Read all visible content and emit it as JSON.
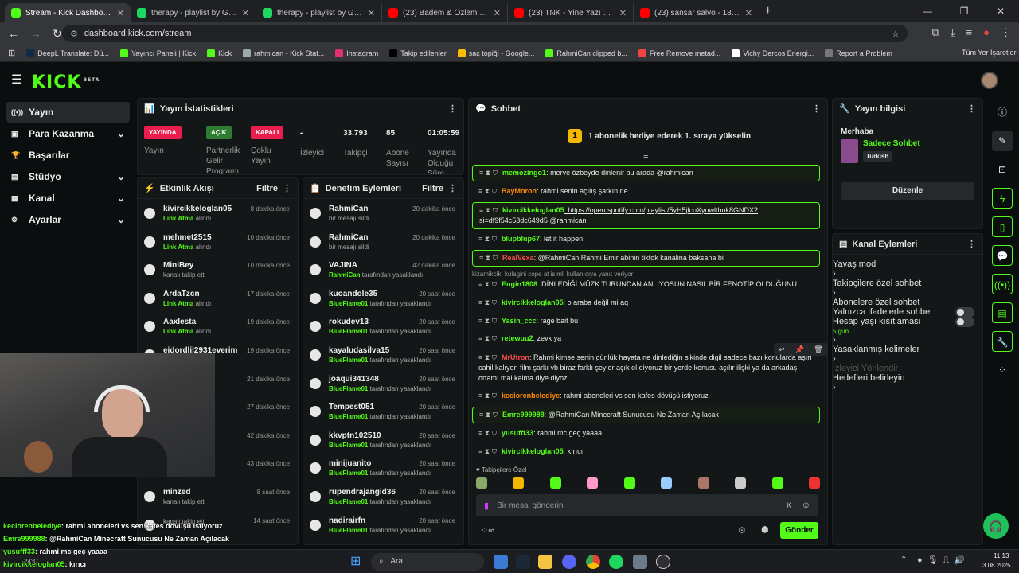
{
  "browser": {
    "tabs": [
      {
        "label": "Stream - Kick Dashboard",
        "color": "#53fc18",
        "active": true
      },
      {
        "label": "therapy - playlist by Gokdeniz",
        "color": "#1ed760"
      },
      {
        "label": "therapy - playlist by Gokdeniz",
        "color": "#1ed760"
      },
      {
        "label": "(23) Badem & Özlem Tekin - Ka",
        "color": "#ff0000"
      },
      {
        "label": "(23) TNK - Yine Yazı Bekleriz (A",
        "color": "#ff0000"
      },
      {
        "label": "(23) sansar salvo - 180 km. - Yo",
        "color": "#ff0000"
      }
    ],
    "url": "dashboard.kick.com/stream",
    "bookmarks": [
      "DeepL Translate: Dü...",
      "Yayıncı Paneli | Kick",
      "Kick",
      "rahmican - Kick Stat...",
      "Instagram",
      "Takip edilenler",
      "saç topiği - Google...",
      "RahmiCan clipped b...",
      "Free Remove metad...",
      "Vichy Dercos Energi...",
      "Report a Problem"
    ],
    "all_bookmarks": "Tüm Yer İşaretleri"
  },
  "kick": {
    "logo": "KICK",
    "logo_sup": "BETA"
  },
  "sidebar": [
    {
      "label": "Yayın",
      "icon": "broadcast-icon",
      "active": true
    },
    {
      "label": "Para Kazanma",
      "icon": "money-icon",
      "chev": true
    },
    {
      "label": "Başarılar",
      "icon": "trophy-icon"
    },
    {
      "label": "Stüdyo",
      "icon": "studio-icon",
      "chev": true
    },
    {
      "label": "Kanal",
      "icon": "channel-icon",
      "chev": true
    },
    {
      "label": "Ayarlar",
      "icon": "settings-icon",
      "chev": true
    }
  ],
  "stats": {
    "title": "Yayın İstatistikleri",
    "items": [
      {
        "badge": "YAYINDA",
        "badge_color": "#e91e4e",
        "label": "Yayın"
      },
      {
        "badge": "AÇIK",
        "badge_color": "#2e7d32",
        "label": "Partnerlik Gelir Programı"
      },
      {
        "badge": "KAPALI",
        "badge_color": "#e91e4e",
        "label": "Çoklu Yayın"
      },
      {
        "value": "-",
        "label": "İzleyici"
      },
      {
        "value": "33.793",
        "label": "Takipçi"
      },
      {
        "value": "85",
        "label": "Abone Sayısı"
      },
      {
        "value": "01:05:59",
        "label": "Yayında Olduğu Süre"
      }
    ]
  },
  "activity": {
    "title": "Etkinlik Akışı",
    "filter": "Filtre",
    "rows": [
      {
        "name": "kivircikkeloglan05",
        "sub_b": "Link Atma",
        "sub": " alındı",
        "time": "8 dakika önce"
      },
      {
        "name": "mehmet2515",
        "sub_b": "Link Atma",
        "sub": " alındı",
        "time": "10 dakika önce"
      },
      {
        "name": "MiniBey",
        "sub_b": "",
        "sub": "kanalı takip etti",
        "time": "10 dakika önce"
      },
      {
        "name": "ArdaTzcn",
        "sub_b": "Link Atma",
        "sub": " alındı",
        "time": "17 dakika önce"
      },
      {
        "name": "Aaxlesta",
        "sub_b": "Link Atma",
        "sub": " alındı",
        "time": "19 dakika önce"
      },
      {
        "name": "eidordlil2931everim",
        "sub_b": "",
        "sub": "",
        "time": "19 dakika önce"
      },
      {
        "name": "",
        "sub_b": "",
        "sub": "",
        "time": "21 dakika önce"
      },
      {
        "name": "",
        "sub_b": "",
        "sub": "",
        "time": "27 dakika önce"
      },
      {
        "name": "",
        "sub_b": "",
        "sub": "",
        "time": "42 dakika önce"
      },
      {
        "name": "",
        "sub_b": "",
        "sub": "kanalı takip etti",
        "time": "43 dakika önce"
      },
      {
        "name": "minzed",
        "sub_b": "",
        "sub": "kanalı takip etti",
        "time": "8 saat önce"
      },
      {
        "name": "",
        "sub_b": "",
        "sub": "kanalı takip etti",
        "time": "14 saat önce"
      }
    ]
  },
  "moderation": {
    "title": "Denetim Eylemleri",
    "filter": "Filtre",
    "rows": [
      {
        "name": "RahmiCan",
        "sub_b": "",
        "sub": "bir mesajı sildi",
        "time": "20 dakika önce"
      },
      {
        "name": "RahmiCan",
        "sub_b": "",
        "sub": "bir mesajı sildi",
        "time": "20 dakika önce"
      },
      {
        "name": "VAJINA",
        "sub_b": "RahmiCan",
        "sub": " tarafından yasaklandı",
        "time": "42 dakika önce"
      },
      {
        "name": "kuoandole35",
        "sub_b": "BlueFlame01",
        "sub": " tarafından yasaklandı",
        "time": "20 saat önce"
      },
      {
        "name": "rokudev13",
        "sub_b": "BlueFlame01",
        "sub": " tarafından yasaklandı",
        "time": "20 saat önce"
      },
      {
        "name": "kayaludasilva15",
        "sub_b": "BlueFlame01",
        "sub": " tarafından yasaklandı",
        "time": "20 saat önce"
      },
      {
        "name": "joaqui341348",
        "sub_b": "BlueFlame01",
        "sub": " tarafından yasaklandı",
        "time": "20 saat önce"
      },
      {
        "name": "Tempest051",
        "sub_b": "BlueFlame01",
        "sub": " tarafından yasaklandı",
        "time": "20 saat önce"
      },
      {
        "name": "kkvptn102510",
        "sub_b": "BlueFlame01",
        "sub": " tarafından yasaklandı",
        "time": "20 saat önce"
      },
      {
        "name": "minijuanito",
        "sub_b": "BlueFlame01",
        "sub": " tarafından yasaklandı",
        "time": "20 saat önce"
      },
      {
        "name": "rupendrajangid36",
        "sub_b": "BlueFlame01",
        "sub": " tarafından yasaklandı",
        "time": "20 saat önce"
      },
      {
        "name": "nadirairfn",
        "sub_b": "BlueFlame01",
        "sub": " tarafından yasaklandı",
        "time": "20 saat önce"
      }
    ]
  },
  "chat": {
    "title": "Sohbet",
    "promo": "1 abonelik hediye ederek 1. sıraya yükselin",
    "messages": [
      {
        "user": "memozingo1",
        "color": "#53fc18",
        "text": ": merve özbeyde dinlenir bu arada @rahmican",
        "hl": true
      },
      {
        "user": "BayMoron",
        "color": "#ff8a00",
        "text": ": rahmi senin açılış şarkın ne"
      },
      {
        "user": "kivircikkeloglan05",
        "color": "#53fc18",
        "text": ": https://open.spotify.com/playlist/5yH5jlcoXyuwlthuk8GNDX?si=df9f54c53dc649d5 @rahmican",
        "hl": true
      },
      {
        "user": "blupblup67",
        "color": "#53fc18",
        "text": ": let it happen"
      },
      {
        "user": "RealVexa",
        "color": "#ff4d4d",
        "text": ": @RahmiCan Rahmi Emir abinin tiktok kanalina baksana bi",
        "hl": true
      },
      {
        "user": "Engin1808",
        "color": "#53fc18",
        "text": ": DİNLEDİĞİ MÜZK TURUNDAN ANLIYOSUN NASIL BİR FENOTİP OLDUĞUNU"
      },
      {
        "user": "kivircikkeloglan05",
        "color": "#53fc18",
        "text": ": o araba değil mi aq"
      },
      {
        "user": "Yasin_ccc",
        "color": "#53fc18",
        "text": ": rage bait bu"
      },
      {
        "user": "retewuu2",
        "color": "#53fc18",
        "text": ": zevk ya"
      },
      {
        "user": "MrUtron",
        "color": "#ff4d4d",
        "text": ": Rahmi kimse senin günlük hayata ne dinlediğin sikinde digil sadece bazı konularda aşırı cahil kalıyon film şarkı vb biraz farklı şeyler açık ol diyoruz bir yerde konusu açılır ilişki ya da arkadaş ortamı mal kalma diye diyoz"
      },
      {
        "user": "keciorenbelediye",
        "color": "#ff8a00",
        "text": ": rahmi aboneleri vs sen kafes dövüşü istiyoruz"
      },
      {
        "user": "Emre999988",
        "color": "#53fc18",
        "text": ": @RahmiCan Minecraft Sunucusu Ne Zaman Açılacak",
        "hl": true
      },
      {
        "user": "yusufff33",
        "color": "#53fc18",
        "text": ": rahmi mc geç yaaaa"
      },
      {
        "user": "kivircikkeloglan05",
        "color": "#53fc18",
        "text": ": kırıcı"
      }
    ],
    "reply_note": "kizamikcik: kulagini cope at isimli kullanıcıya yanıt veriyor",
    "followers_only": "Takipçilere Özel",
    "input_placeholder": "Bir mesaj gönderin",
    "send": "Gönder"
  },
  "stream_info": {
    "title": "Yayın bilgisi",
    "hello": "Merhaba",
    "stream_title": "Sadece Sohbet",
    "lang": "Turkish",
    "edit": "Düzenle"
  },
  "channel_actions": {
    "title": "Kanal Eylemleri",
    "items": [
      {
        "label": "Yavaş mod",
        "type": "arrow"
      },
      {
        "label": "Takipçilere özel sohbet",
        "type": "arrow"
      },
      {
        "label": "Abonelere özel sohbet",
        "type": "toggle"
      },
      {
        "label": "Yalnızca ifadelerle sohbet",
        "type": "toggle"
      },
      {
        "label": "Hesap yaşı kısıtlaması",
        "sub": "5 gün",
        "type": "arrow"
      },
      {
        "label": "Yasaklanmış kelimeler",
        "type": "arrow"
      },
      {
        "label": "İzleyici Yönlendir",
        "type": "disabled"
      },
      {
        "label": "Hedefleri belirleyin",
        "type": "arrow"
      }
    ]
  },
  "overlay_chat": [
    {
      "user": "keciorenbelediye",
      "text": ": rahmi aboneleri vs sen kafes dövüşü istiyoruz"
    },
    {
      "user": "Emre999988",
      "text": ": @RahmiCan Minecraft Sunucusu Ne Zaman Açılacak"
    },
    {
      "user": "yusufff33",
      "text": ": rahmi mc geç yaaaa"
    },
    {
      "user": "kivircikkeloglan05",
      "text": ": kırıcı"
    }
  ],
  "taskbar": {
    "search": "Ara",
    "time": "11:13",
    "date": "3.08.2025",
    "weather": "24°C"
  }
}
